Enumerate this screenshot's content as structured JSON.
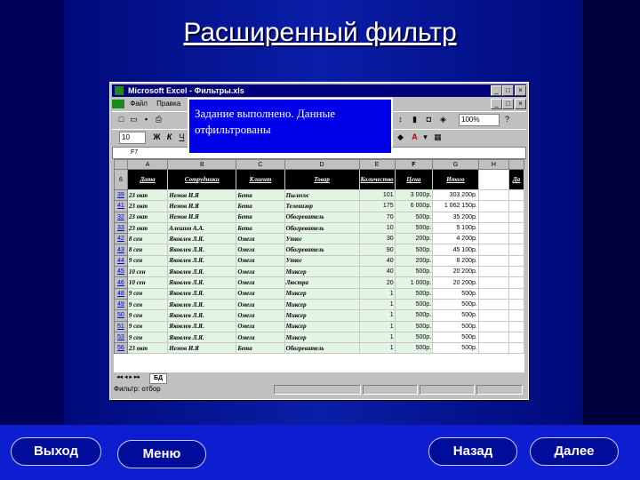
{
  "slide": {
    "title": "Расширенный фильтр"
  },
  "popup": {
    "message": "Задание выполнено. Данные отфильтрованы"
  },
  "excel": {
    "window_title": "Microsoft Excel - Фильтры.xls",
    "menu": [
      "Файл",
      "Правка"
    ],
    "font_size": "10",
    "zoom": "100%",
    "cell_ref": "F7",
    "columns": [
      "A",
      "B",
      "C",
      "D",
      "E",
      "F",
      "G",
      "H"
    ],
    "header_row_number": "6",
    "headers": [
      "Дата",
      "Сотрудники",
      "Клиент",
      "Товар",
      "Количество",
      "Цена",
      "Итого",
      "",
      "Да"
    ],
    "rows": [
      {
        "n": "39",
        "date": "23 окт",
        "emp": "Немов И.Я",
        "client": "Бета",
        "product": "Пылесос",
        "qty": "101",
        "price": "3 000р.",
        "total": "303 200р."
      },
      {
        "n": "41",
        "date": "23 окт",
        "emp": "Немов И.Я",
        "client": "Бета",
        "product": "Телевизор",
        "qty": "175",
        "price": "6 000р.",
        "total": "1 062 150р."
      },
      {
        "n": "32",
        "date": "23 окт",
        "emp": "Немов И.Я",
        "client": "Бета",
        "product": "Обогреватель",
        "qty": "70",
        "price": "500р.",
        "total": "35 200р."
      },
      {
        "n": "33",
        "date": "23 окт",
        "emp": "Алешин А.А.",
        "client": "Бета",
        "product": "Обогреватель",
        "qty": "10",
        "price": "500р.",
        "total": "5 100р."
      },
      {
        "n": "42",
        "date": "8 сен",
        "emp": "Яковлев Л.Я.",
        "client": "Омега",
        "product": "Утюг",
        "qty": "30",
        "price": "200р.",
        "total": "4 200р."
      },
      {
        "n": "43",
        "date": "8 сен",
        "emp": "Яковлев Л.Я.",
        "client": "Омега",
        "product": "Обогреватель",
        "qty": "90",
        "price": "500р.",
        "total": "45 100р."
      },
      {
        "n": "44",
        "date": "9 сен",
        "emp": "Яковлев Л.Я.",
        "client": "Омега",
        "product": "Утюг",
        "qty": "40",
        "price": "200р.",
        "total": "8 200р."
      },
      {
        "n": "45",
        "date": "10 сен",
        "emp": "Яковлев Л.Я.",
        "client": "Омега",
        "product": "Миксер",
        "qty": "40",
        "price": "500р.",
        "total": "20 200р."
      },
      {
        "n": "46",
        "date": "10 сен",
        "emp": "Яковлев Л.Я.",
        "client": "Омега",
        "product": "Люстра",
        "qty": "20",
        "price": "1 000р.",
        "total": "20 200р."
      },
      {
        "n": "48",
        "date": "9 сен",
        "emp": "Яковлев Л.Я.",
        "client": "Омега",
        "product": "Миксер",
        "qty": "1",
        "price": "500р.",
        "total": "500р."
      },
      {
        "n": "49",
        "date": "9 сен",
        "emp": "Яковлев Л.Я.",
        "client": "Омега",
        "product": "Миксер",
        "qty": "1",
        "price": "500р.",
        "total": "500р."
      },
      {
        "n": "50",
        "date": "9 сен",
        "emp": "Яковлев Л.Я.",
        "client": "Омега",
        "product": "Миксер",
        "qty": "1",
        "price": "500р.",
        "total": "500р."
      },
      {
        "n": "51",
        "date": "9 сен",
        "emp": "Яковлев Л.Я.",
        "client": "Омега",
        "product": "Миксер",
        "qty": "1",
        "price": "500р.",
        "total": "500р."
      },
      {
        "n": "53",
        "date": "9 сен",
        "emp": "Яковлев Л.Я.",
        "client": "Омега",
        "product": "Миксер",
        "qty": "1",
        "price": "500р.",
        "total": "500р."
      },
      {
        "n": "56",
        "date": "23 окт",
        "emp": "Немов И.Я",
        "client": "Бета",
        "product": "Обогреватель",
        "qty": "1",
        "price": "500р.",
        "total": "500р."
      }
    ],
    "sheet_tab": "БД",
    "status": "Фильтр: отбор"
  },
  "nav": {
    "exit_label": "Выход",
    "menu_label": "Меню",
    "back_label": "Назад",
    "next_label": "Далее"
  },
  "colors": {
    "popup_bg": "#0000e8",
    "title_bar": "#00007a",
    "nav_button": "#000c9a",
    "bottom_bar": "#0c1ed0"
  }
}
